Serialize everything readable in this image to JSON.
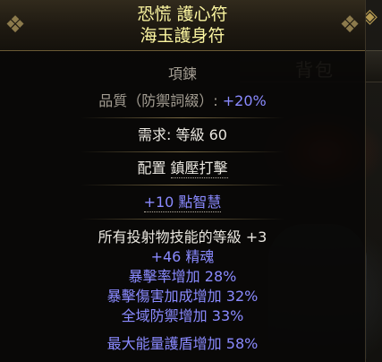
{
  "inventory": {
    "title": "背包"
  },
  "tooltip": {
    "name": "恐慌 護心符",
    "base_type": "海玉護身符",
    "item_class": "項鍊",
    "quality_label": "品質（防禦詞綴）: ",
    "quality_value": "+20%",
    "requirement": "需求: 等級 60",
    "anoint_prefix": "配置 ",
    "anoint_value": "鎮壓打擊",
    "implicit": "+10 點智慧",
    "explicit_mods": [
      "所有投射物技能的等級 +3",
      "+46 精魂",
      "暴擊率增加 28%",
      "暴擊傷害加成增加 32%",
      "全域防禦增加 33%",
      "最大能量護盾增加 58%"
    ]
  },
  "colors": {
    "unique_name": "#fbf5a0",
    "magic_mod": "#8a8aff",
    "label_grey": "#a39d92",
    "text_white": "#e9e6df"
  }
}
